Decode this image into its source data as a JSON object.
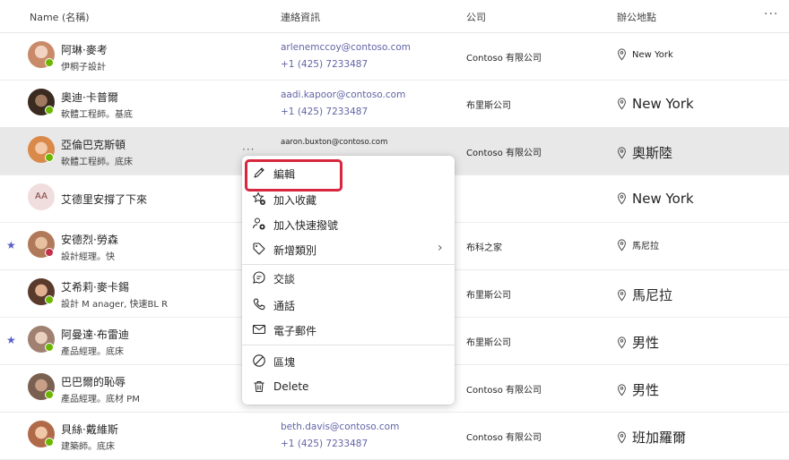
{
  "header": {
    "name_col": "Name (名稱)",
    "contact_col": "連絡資訊",
    "company_col": "公司",
    "office_col": "辦公地點"
  },
  "contacts": [
    {
      "name": "阿琳·麥考",
      "title": "伊桐子設計",
      "email": "arlenemccoy@contoso.com",
      "phone": "+1 (425) 7233487",
      "company": "Contoso 有限公司",
      "office": "New York",
      "presence": "green",
      "face": "#c98a6a"
    },
    {
      "name": "奧迪·卡普爾",
      "title": "軟體工程師。基底",
      "email": "aadi.kapoor@contoso.com",
      "phone": "+1 (425) 7233487",
      "company": "布里斯公司",
      "office": "New York",
      "presence": "green",
      "face": "#6a4a3a"
    },
    {
      "name": "亞倫巴克斯頓",
      "title": "軟體工程師。底床",
      "email": "aaron.buxton@contoso.com",
      "phone": "",
      "company": "Contoso 有限公司",
      "office": "奧斯陸",
      "presence": "green",
      "face": "#d98a4a"
    },
    {
      "name": "艾德里安撐了下來",
      "title": "",
      "initials": "AA",
      "email": "",
      "phone": "",
      "company": "",
      "office": "New York",
      "presence": "none"
    },
    {
      "name": "安德烈·勞森",
      "title": "設計經理。快",
      "email": "",
      "phone": "",
      "company": "布科之家",
      "office": "馬尼拉",
      "presence": "red",
      "face": "#b07a5a"
    },
    {
      "name": "艾希莉·麥卡錫",
      "title": "設計 M      anager, 快速BL R",
      "email": "",
      "phone": "",
      "company": "布里斯公司",
      "office": "馬尼拉",
      "presence": "green",
      "face": "#8a5a3a"
    },
    {
      "name": "阿曼達·布雷迪",
      "title": "產品經理。底床",
      "email": "",
      "phone": "",
      "company": "布里斯公司",
      "office": "男性",
      "presence": "green",
      "face": "#a08070"
    },
    {
      "name": "巴巴爾的恥辱",
      "title": "產品經理。底材 PM",
      "email": "",
      "phone": "",
      "company": "Contoso 有限公司",
      "office": "男性",
      "presence": "green",
      "face": "#7a6050"
    },
    {
      "name": "貝絲·戴維斯",
      "title": "建築師。底床",
      "email": "beth.davis@contoso.com",
      "phone": "+1 (425) 7233487",
      "company": "Contoso 有限公司",
      "office": "班加羅爾",
      "presence": "green",
      "face": "#b06a4a"
    }
  ],
  "context_menu": {
    "edit": "編輯",
    "add_favorite": "加入收藏",
    "add_speed_dial": "加入快速撥號",
    "add_category": "新增類別",
    "chat": "交談",
    "call": "通話",
    "email": "電子郵件",
    "block": "區塊",
    "delete": "Delete"
  },
  "colors": {
    "accent": "#6264a7",
    "highlight": "#d7263d",
    "selected_row": "#e8e8e8",
    "favorite_star": "#5b5fc7"
  }
}
